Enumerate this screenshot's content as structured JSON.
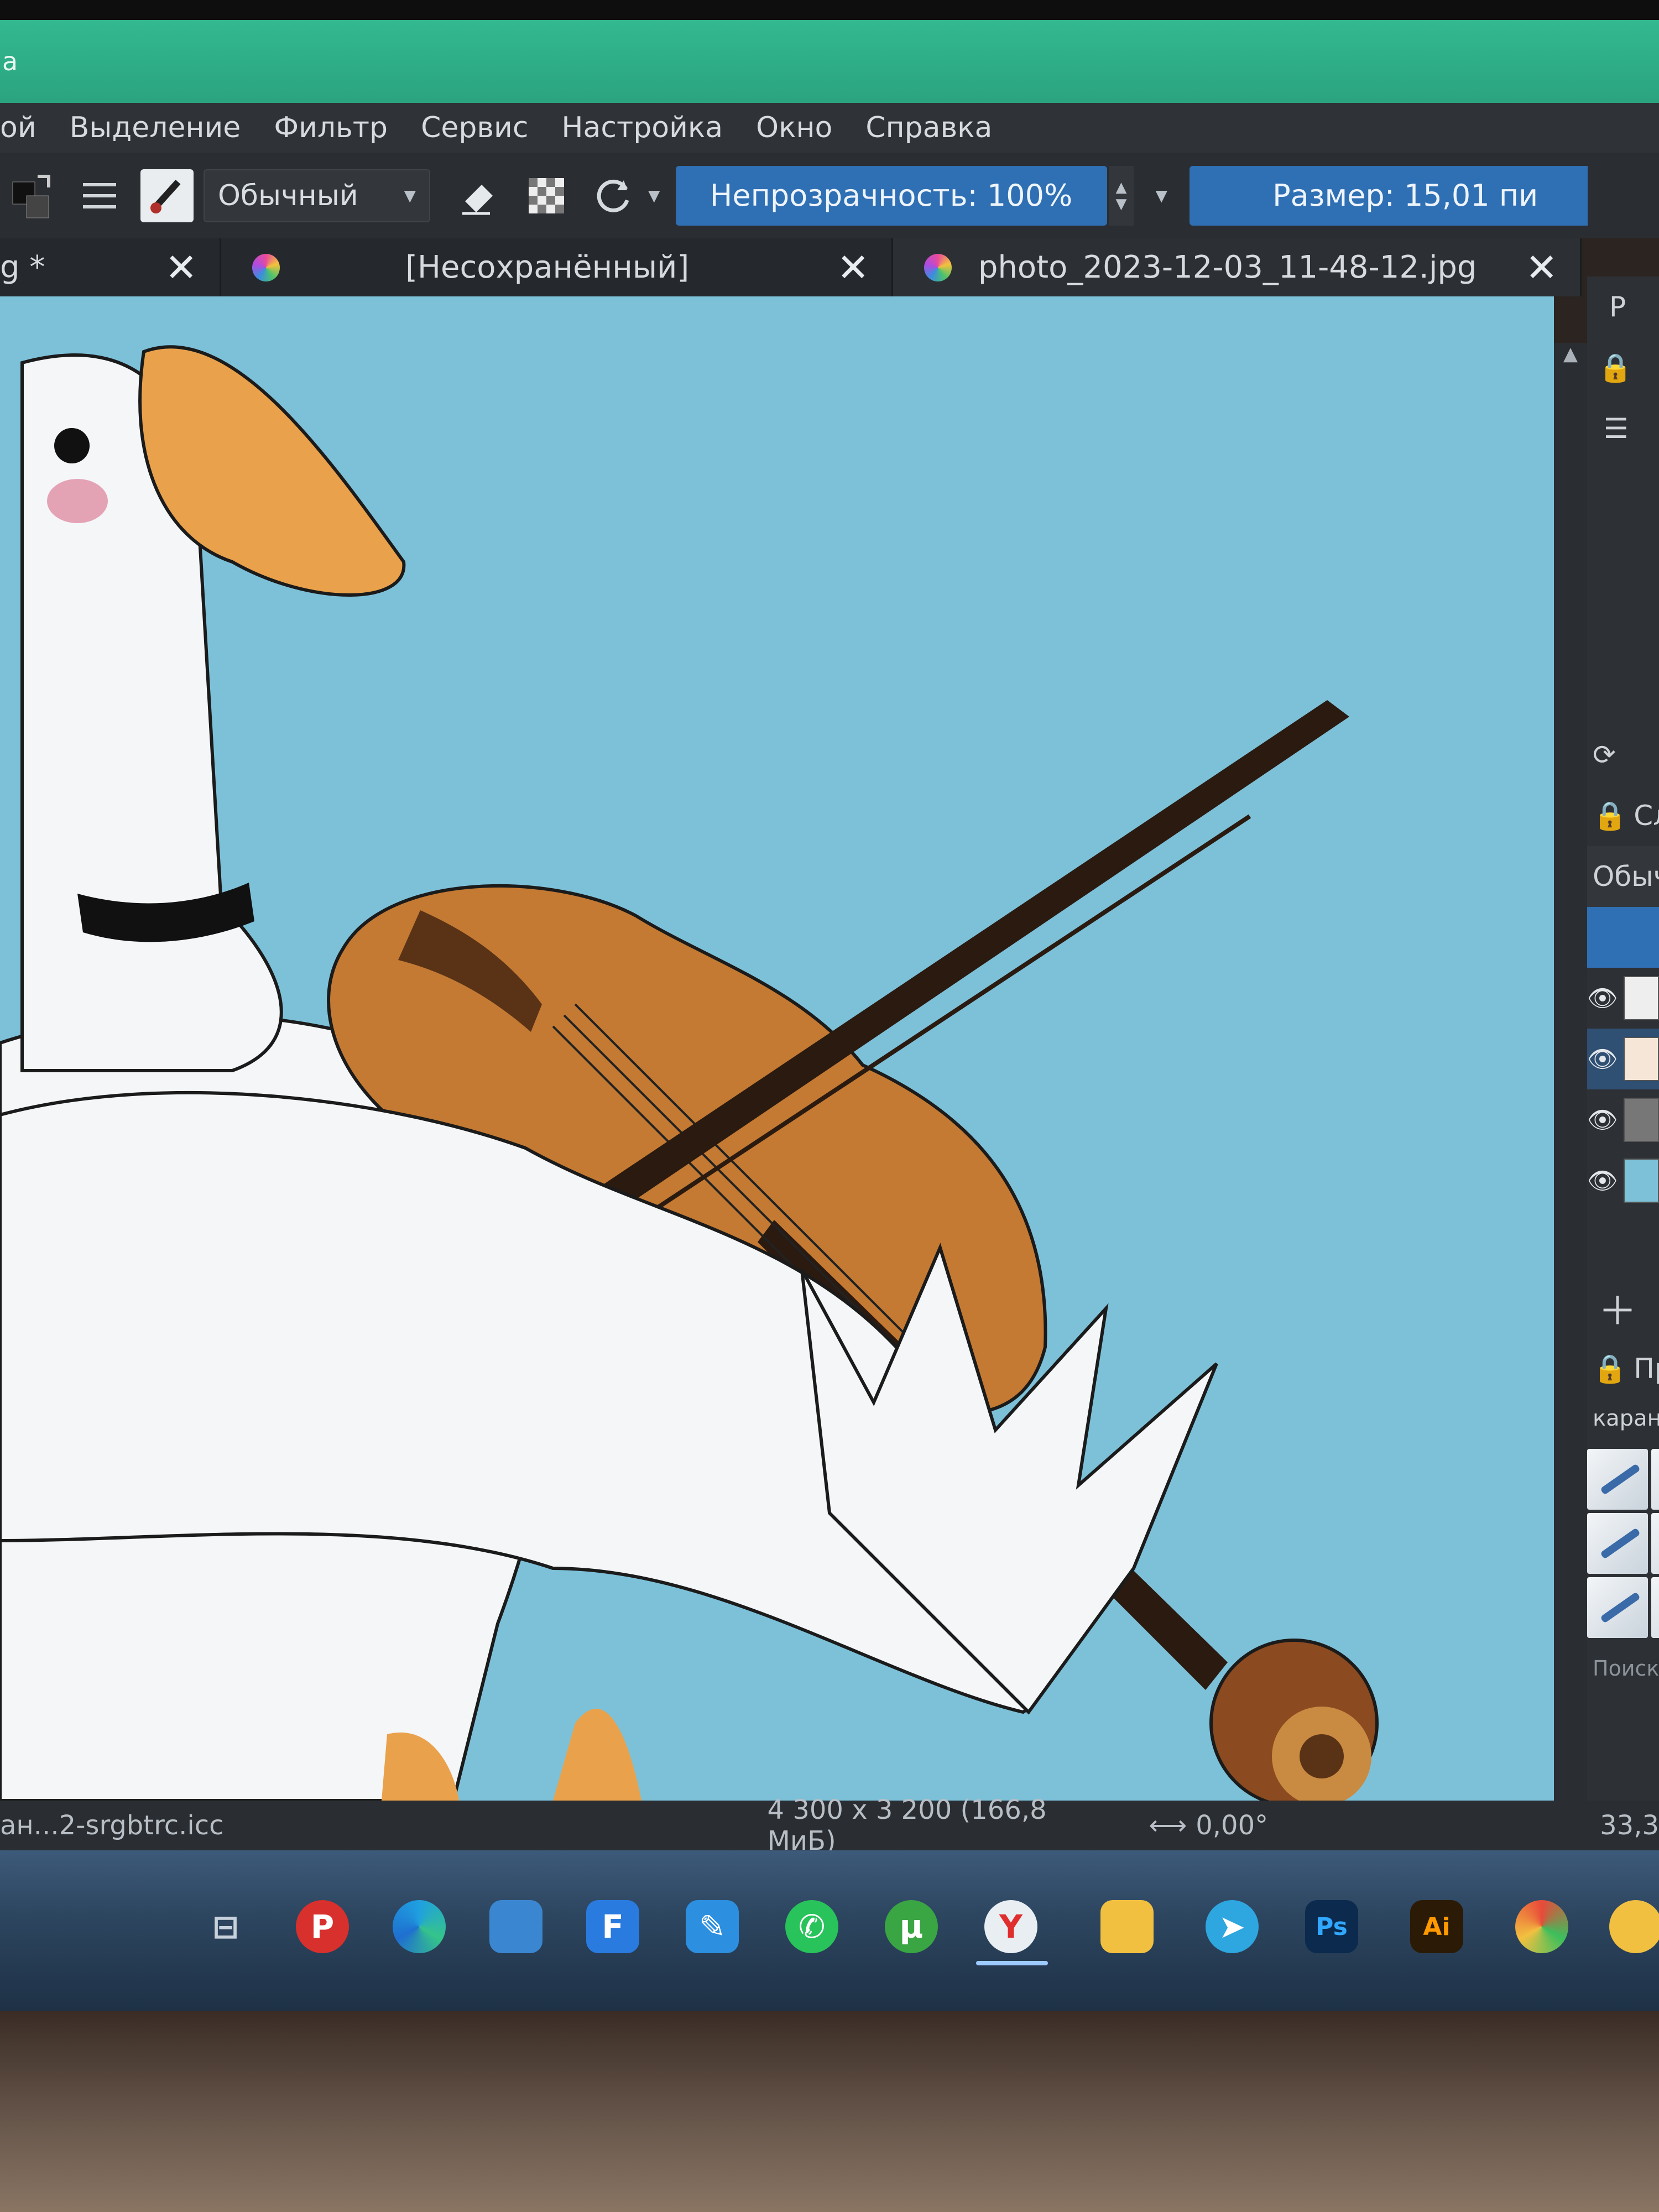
{
  "window": {
    "title_fragment": "a"
  },
  "menu": {
    "items": [
      "ой",
      "Выделение",
      "Фильтр",
      "Сервис",
      "Настройка",
      "Окно",
      "Справка"
    ]
  },
  "toolbar": {
    "blend_mode": "Обычный",
    "opacity_label": "Непрозрачность: 100%",
    "size_label": "Размер: 15,01 пи"
  },
  "tabs": [
    {
      "label": "g *",
      "active": false
    },
    {
      "label": "[Несохранённый]",
      "active": false
    },
    {
      "label": "photo_2023-12-03_11-48-12.jpg",
      "active": true
    }
  ],
  "docker": {
    "tab_fragment": "P",
    "layers_header": "Сло",
    "blend_mode": "Обычн",
    "profile_label": "Профили",
    "brush_tag": "карандаш",
    "search_placeholder": "Поиск"
  },
  "status": {
    "color_profile": "ан...2-srgbtrc.icc",
    "dimensions": "4 300 x 3 200 (166,8 МиБ)",
    "rotation": "0,00°",
    "zoom_fragment": "33,3"
  },
  "taskbar": {
    "icons": [
      "task-view",
      "p-app",
      "edge",
      "media-app",
      "f-app",
      "pen-app",
      "whatsapp",
      "torrent",
      "yandex-browser",
      "file-explorer",
      "telegram",
      "photoshop",
      "illustrator",
      "globe-app",
      "yellow-app"
    ],
    "labels": {
      "photoshop": "Ps",
      "illustrator": "Ai",
      "p_app": "P",
      "f_app": "F",
      "yandex": "Y"
    }
  },
  "colors": {
    "accent_title": "#2aa47f",
    "canvas_bg": "#7cc0d8",
    "highlight": "#2f6fb3",
    "panel": "#2d3034"
  }
}
